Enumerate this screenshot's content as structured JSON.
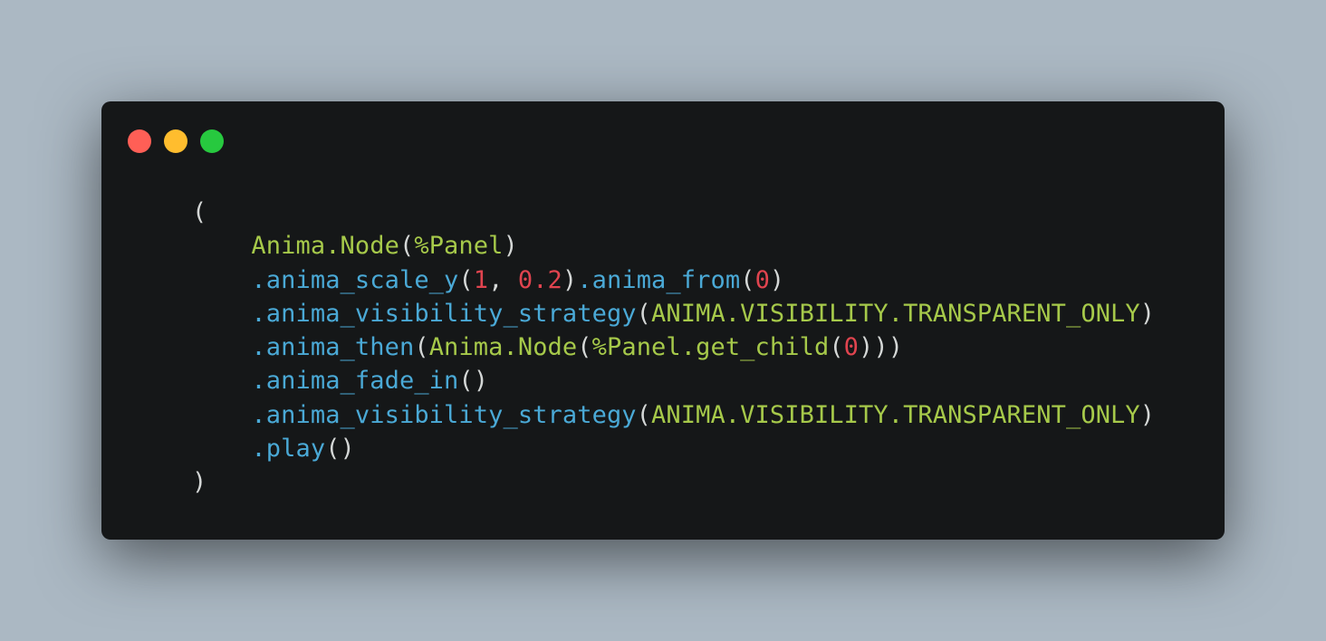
{
  "window_controls": [
    {
      "name": "close-button",
      "color": "#ff5f56"
    },
    {
      "name": "minimize-button",
      "color": "#ffbd2e"
    },
    {
      "name": "maximize-button",
      "color": "#27c93f"
    }
  ],
  "colors": {
    "background": "#abb8c3",
    "editor_background": "#151718",
    "plain": "#d4d7d6",
    "class": "#a6c94a",
    "method": "#4aa9d6",
    "number": "#e0444f"
  },
  "code_lines": [
    [
      {
        "t": "(",
        "k": "paren"
      }
    ],
    [
      {
        "t": "    ",
        "k": "plain"
      },
      {
        "t": "Anima.Node",
        "k": "class"
      },
      {
        "t": "(",
        "k": "paren"
      },
      {
        "t": "%Panel",
        "k": "class"
      },
      {
        "t": ")",
        "k": "paren"
      }
    ],
    [
      {
        "t": "    ",
        "k": "plain"
      },
      {
        "t": ".anima_scale_y",
        "k": "method"
      },
      {
        "t": "(",
        "k": "paren"
      },
      {
        "t": "1",
        "k": "number"
      },
      {
        "t": ", ",
        "k": "plain"
      },
      {
        "t": "0.2",
        "k": "number"
      },
      {
        "t": ")",
        "k": "paren"
      },
      {
        "t": ".anima_from",
        "k": "method"
      },
      {
        "t": "(",
        "k": "paren"
      },
      {
        "t": "0",
        "k": "number"
      },
      {
        "t": ")",
        "k": "paren"
      }
    ],
    [
      {
        "t": "    ",
        "k": "plain"
      },
      {
        "t": ".anima_visibility_strategy",
        "k": "method"
      },
      {
        "t": "(",
        "k": "paren"
      },
      {
        "t": "ANIMA.VISIBILITY.TRANSPARENT_ONLY",
        "k": "constant"
      },
      {
        "t": ")",
        "k": "paren"
      }
    ],
    [
      {
        "t": "    ",
        "k": "plain"
      },
      {
        "t": ".anima_then",
        "k": "method"
      },
      {
        "t": "(",
        "k": "paren"
      },
      {
        "t": "Anima.Node",
        "k": "class"
      },
      {
        "t": "(",
        "k": "paren"
      },
      {
        "t": "%Panel.get_child",
        "k": "class"
      },
      {
        "t": "(",
        "k": "paren"
      },
      {
        "t": "0",
        "k": "number"
      },
      {
        "t": ")))",
        "k": "paren"
      }
    ],
    [
      {
        "t": "    ",
        "k": "plain"
      },
      {
        "t": ".anima_fade_in",
        "k": "method"
      },
      {
        "t": "()",
        "k": "paren"
      }
    ],
    [
      {
        "t": "    ",
        "k": "plain"
      },
      {
        "t": ".anima_visibility_strategy",
        "k": "method"
      },
      {
        "t": "(",
        "k": "paren"
      },
      {
        "t": "ANIMA.VISIBILITY.TRANSPARENT_ONLY",
        "k": "constant"
      },
      {
        "t": ")",
        "k": "paren"
      }
    ],
    [
      {
        "t": "    ",
        "k": "plain"
      },
      {
        "t": ".play",
        "k": "method"
      },
      {
        "t": "()",
        "k": "paren"
      }
    ],
    [
      {
        "t": ")",
        "k": "paren"
      }
    ]
  ]
}
